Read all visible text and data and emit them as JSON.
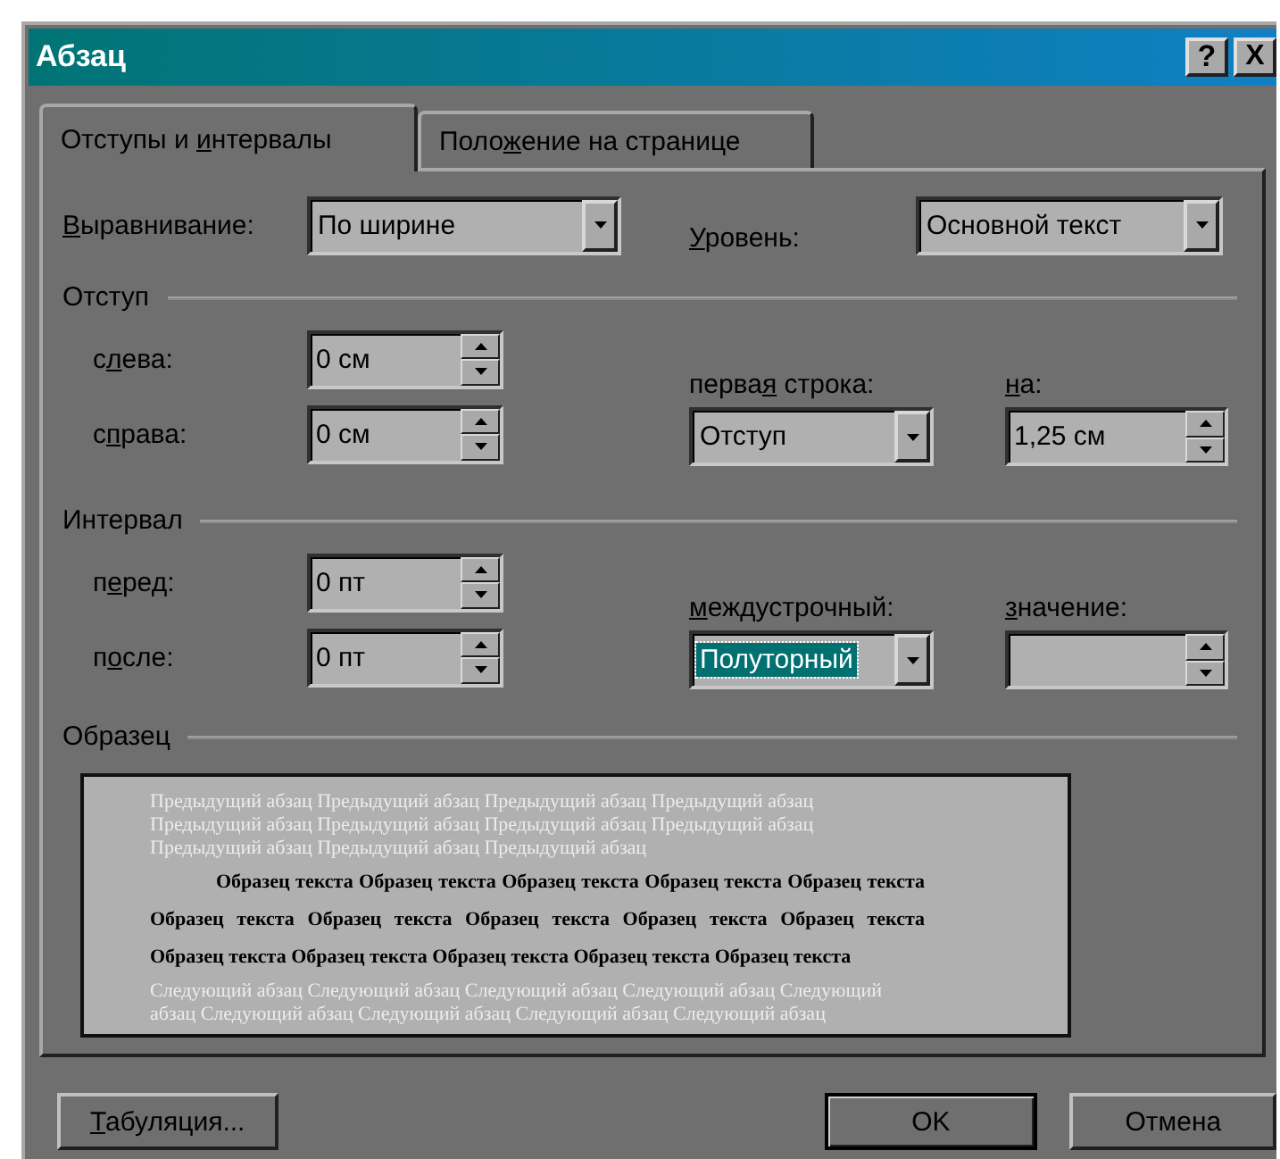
{
  "window": {
    "title": "Абзац",
    "buttons": [
      {
        "kind": "help",
        "label": "?"
      },
      {
        "kind": "close",
        "label": "X"
      }
    ]
  },
  "tabs": [
    {
      "label": {
        "pre": "Отступы и ",
        "key": "и",
        "post": "нтервалы"
      },
      "selected": true
    },
    {
      "label": {
        "pre": "Поло",
        "key": "ж",
        "post": "ение на странице"
      },
      "selected": false
    }
  ],
  "alignment": {
    "label": {
      "key": "В",
      "post": "ыравнивание:"
    },
    "value": "По ширине"
  },
  "outline_level": {
    "label": {
      "key": "У",
      "post": "ровень:"
    },
    "value": "Основной текст"
  },
  "indent": {
    "title": "Отступ",
    "left": {
      "label": {
        "pre": "с",
        "key": "л",
        "post": "ева:"
      },
      "value": "0 см"
    },
    "right": {
      "label": {
        "pre": "с",
        "key": "п",
        "post": "рава:"
      },
      "value": "0 см"
    },
    "first_line": {
      "label": {
        "pre": "перва",
        "key": "я",
        "post": " строка:"
      },
      "value": "Отступ",
      "focused": false
    },
    "by": {
      "label": {
        "key": "н",
        "post": "а:"
      },
      "value": "1,25 см"
    }
  },
  "spacing": {
    "title": "Интервал",
    "before": {
      "label": {
        "pre": "п",
        "key": "е",
        "post": "ред:"
      },
      "value": "0 пт"
    },
    "after": {
      "label": {
        "pre": "п",
        "key": "о",
        "post": "сле:"
      },
      "value": "0 пт"
    },
    "line_spacing": {
      "label": {
        "key": "м",
        "post": "еждустрочный:"
      },
      "value": "Полуторный",
      "focused": true
    },
    "at": {
      "label": {
        "key": "з",
        "post": "начение:"
      }
    }
  },
  "preview": {
    "title": "Образец",
    "previous": "Предыдущий абзац Предыдущий абзац Предыдущий абзац Предыдущий абзац Предыдущий абзац Предыдущий абзац Предыдущий абзац Предыдущий абзац Предыдущий абзац Предыдущий абзац Предыдущий абзац",
    "sample": "Образец текста Образец текста Образец текста Образец текста Образец текста Образец текста Образец текста Образец текста Образец текста Образец текста Образец текста Образец текста Образец текста Образец текста Образец текста",
    "next": "Следующий абзац Следующий абзац Следующий абзац Следующий абзац Следующий абзац Следующий абзац Следующий абзац Следующий абзац Следующий абзац"
  },
  "buttons": [
    {
      "label": {
        "key": "Т",
        "post": "абуляция..."
      },
      "default": false
    },
    {
      "label": {
        "pre": "OK"
      },
      "default": true
    },
    {
      "label": {
        "pre": "Отмена"
      },
      "default": false
    }
  ]
}
